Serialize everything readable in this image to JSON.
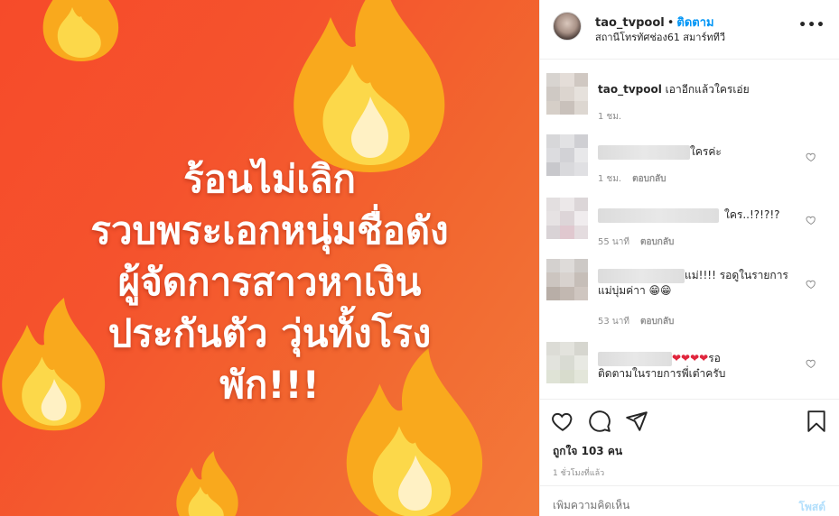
{
  "post": {
    "image_text": [
      "ร้อนไม่เลิก",
      "รวบพระเอกหนุ่มชื่อดัง",
      "ผู้จัดการสาวหาเงิน",
      "ประกันตัว วุ่นทั้งโรง",
      "พัก!!!"
    ]
  },
  "header": {
    "username": "tao_tvpool",
    "separator": "•",
    "follow_label": "ติดตาม",
    "subtitle": "สถานีโทรทัศช่อง61 สมาร์ททีวี",
    "more_label": "•••"
  },
  "comments": [
    {
      "user": "tao_tvpool",
      "text": "เอาอีกแล้วใครเอ่ย",
      "time": "1 ชม.",
      "reply": ""
    },
    {
      "user": "",
      "text": "ใครค่ะ",
      "time": "1 ชม.",
      "reply": "ตอบกลับ"
    },
    {
      "user": "",
      "text": "ใคร..!?!?!?",
      "time": "55 นาที",
      "reply": "ตอบกลับ"
    },
    {
      "user": "",
      "text_line1": "แม่!!!! รอดูในรายการ",
      "text_line2": "แม่บุ่มค่าา 😁😁",
      "time": "53 นาที",
      "reply": "ตอบกลับ"
    },
    {
      "user": "",
      "hearts": "❤❤❤❤",
      "text_line1": "รอ",
      "text_line2": "ติดตามในรายการพี่เต๋าครับ",
      "time": "",
      "reply": ""
    }
  ],
  "actions": {
    "likes": "ถูกใจ 103 คน",
    "timestamp": "1 ชั่วโมงที่แล้ว",
    "icons": [
      "heart-icon",
      "comment-icon",
      "share-icon",
      "bookmark-icon"
    ]
  },
  "add_comment": {
    "placeholder": "เพิ่มความคิดเห็น",
    "post_label": "โพสต์"
  },
  "colors": {
    "accent": "#0095f6",
    "image_bg": "#f5532d",
    "post_disabled": "#b2dffc"
  }
}
